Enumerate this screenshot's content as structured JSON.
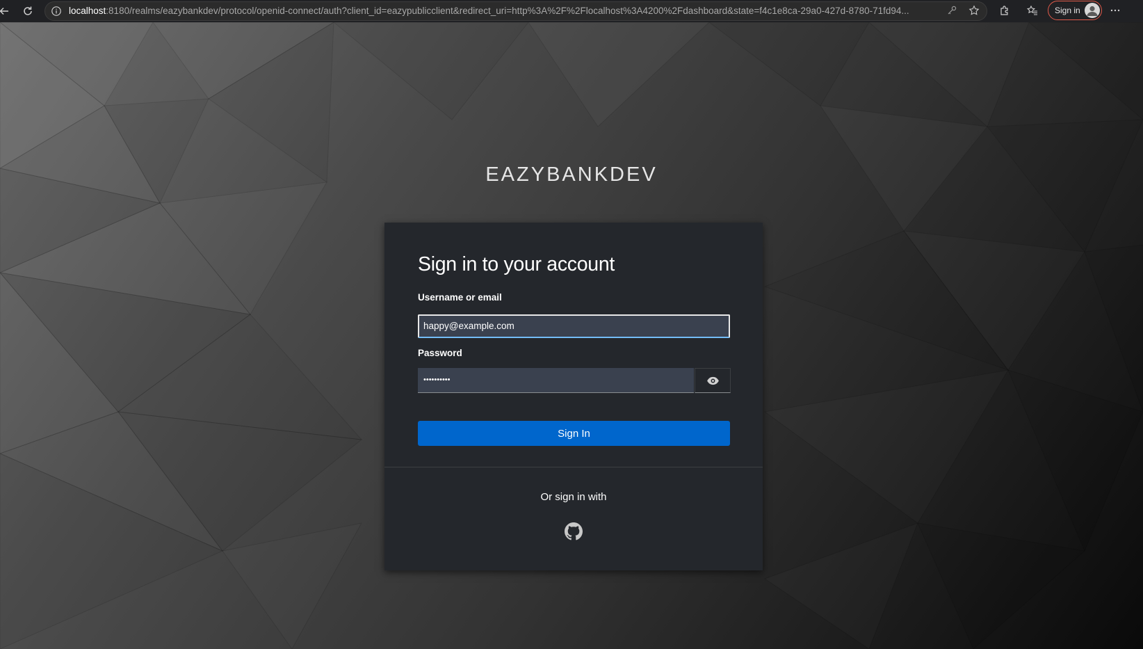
{
  "browser": {
    "url_host": "localhost",
    "url_rest": ":8180/realms/eazybankdev/protocol/openid-connect/auth?client_id=eazypublicclient&redirect_uri=http%3A%2F%2Flocalhost%3A4200%2Fdashboard&state=f4c1e8ca-29a0-427d-8780-71fd94...",
    "profile_label": "Sign in",
    "icons": [
      "back-arrow-icon",
      "reload-icon",
      "site-info-icon",
      "key-icon",
      "star-icon",
      "extensions-icon",
      "favorites-icon",
      "profile-avatar-icon",
      "more-icon"
    ]
  },
  "realm": {
    "brand": "EAZYBANKDEV"
  },
  "login": {
    "heading": "Sign in to your account",
    "username_label": "Username or email",
    "username_value": "happy@example.com",
    "password_label": "Password",
    "password_value": "••••••••••",
    "signin_button": "Sign In",
    "social_text": "Or sign in with",
    "social_provider_icon": "github-icon",
    "show_password_icon": "eye-icon"
  },
  "colors": {
    "primary_button": "#0066cc",
    "card_bg": "#24272c",
    "input_bg": "#3a414f",
    "focus_underline": "#73bcf7"
  }
}
